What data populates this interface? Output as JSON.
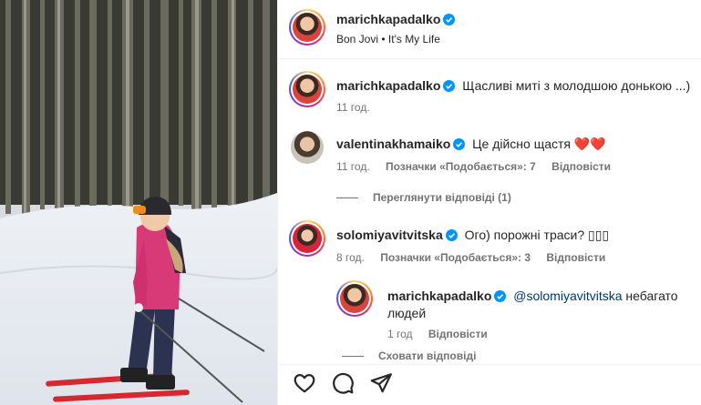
{
  "header": {
    "username": "marichkapadalko",
    "music": "Bon Jovi • It's My Life"
  },
  "caption": {
    "username": "marichkapadalko",
    "text": "Щасливі миті з молодшою донькою ...)",
    "time": "11 год."
  },
  "comments": [
    {
      "username": "valentinakhamaiko",
      "text": "Це дійсно щастя",
      "emoji": "❤️❤️",
      "time": "11 год.",
      "likes": "Позначки «Подобається»: 7",
      "reply_label": "Відповісти",
      "thread_label": "Переглянути відповіді (1)"
    },
    {
      "username": "solomiyavitvitska",
      "text": "Ого) порожні траси? ",
      "emoji": "▯▯▯",
      "time": "8 год.",
      "likes": "Позначки «Подобається»: 3",
      "reply_label": "Відповісти",
      "reply": {
        "username": "marichkapadalko",
        "mention": "@solomiyavitvitska",
        "text_line1": "небагато",
        "text_line2": "людей",
        "time": "1 год",
        "reply_label": "Відповісти"
      },
      "thread_label": "Сховати відповіді"
    }
  ],
  "actions": {
    "like_icon": "heart-outline-icon",
    "comment_icon": "comment-bubble-icon",
    "share_icon": "paper-plane-icon"
  },
  "colors": {
    "verified": "#0095f6",
    "meta": "#737373",
    "mention": "#00376b",
    "heart": "#e0245e"
  }
}
